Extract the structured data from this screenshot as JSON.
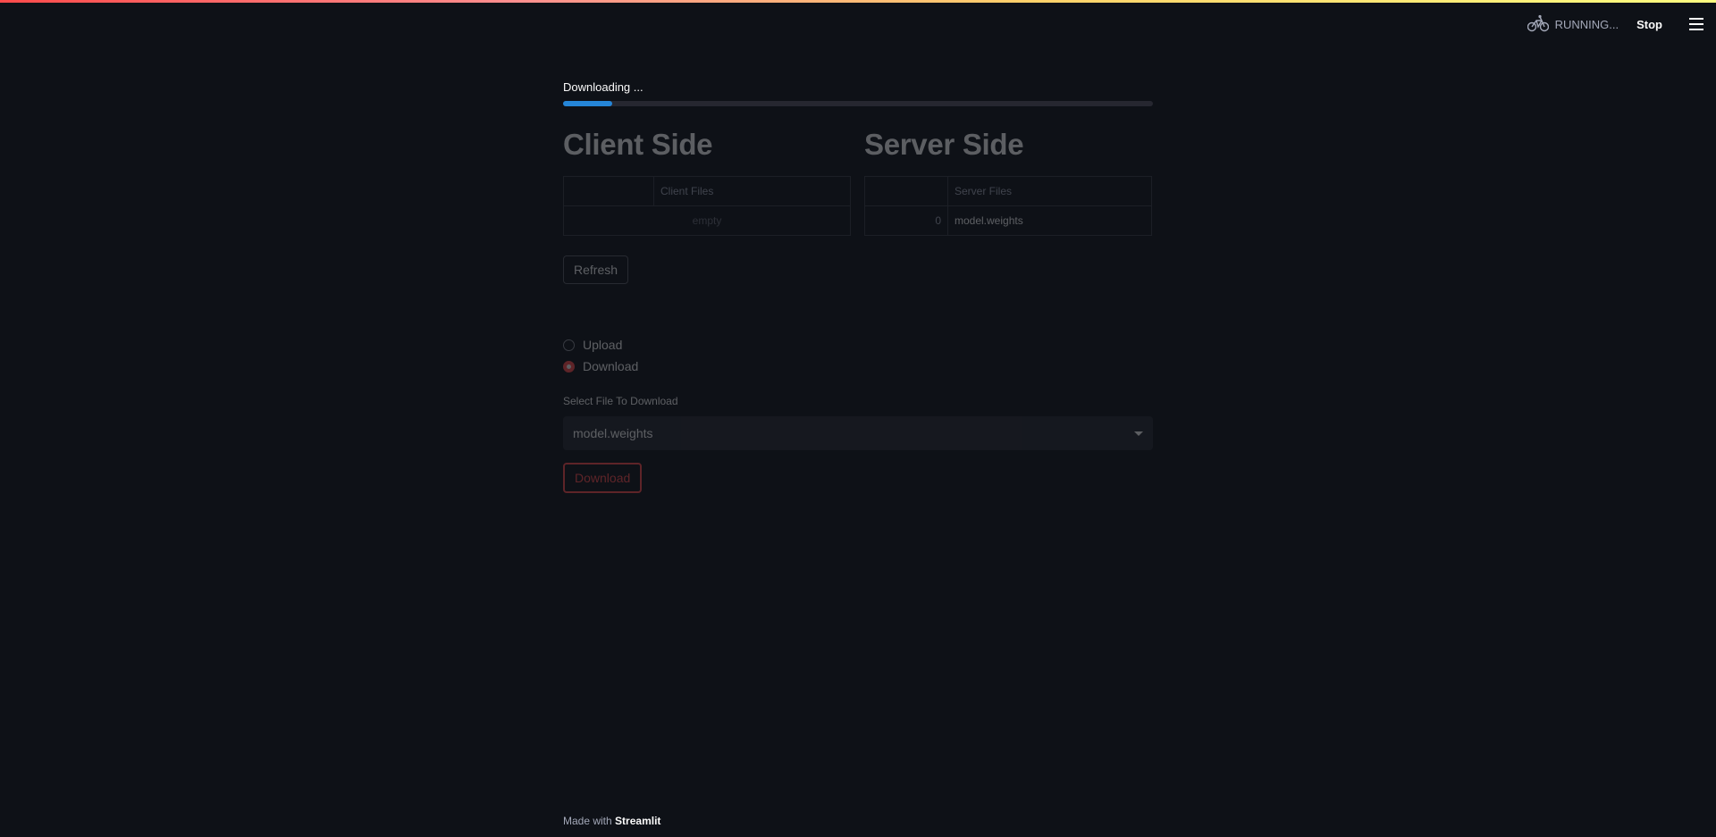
{
  "header": {
    "status_text": "RUNNING...",
    "stop_label": "Stop",
    "status_icon": "bicycle-icon",
    "menu_icon": "hamburger-menu-icon"
  },
  "progress": {
    "label": "Downloading ...",
    "value": 0.083
  },
  "client": {
    "title": "Client Side",
    "column": "Client Files",
    "empty_text": "empty"
  },
  "server": {
    "title": "Server Side",
    "column": "Server Files",
    "rows": [
      {
        "index": "0",
        "value": "model.weights"
      }
    ]
  },
  "refresh_label": "Refresh",
  "mode": {
    "options": [
      "Upload",
      "Download"
    ],
    "selected": "Download"
  },
  "select": {
    "label": "Select File To Download",
    "value": "model.weights"
  },
  "download_label": "Download",
  "footer": {
    "prefix": "Made with",
    "brand": "Streamlit"
  },
  "colors": {
    "background": "#0e1117",
    "accent": "#ff4b4b",
    "progress": "#2586d8"
  }
}
